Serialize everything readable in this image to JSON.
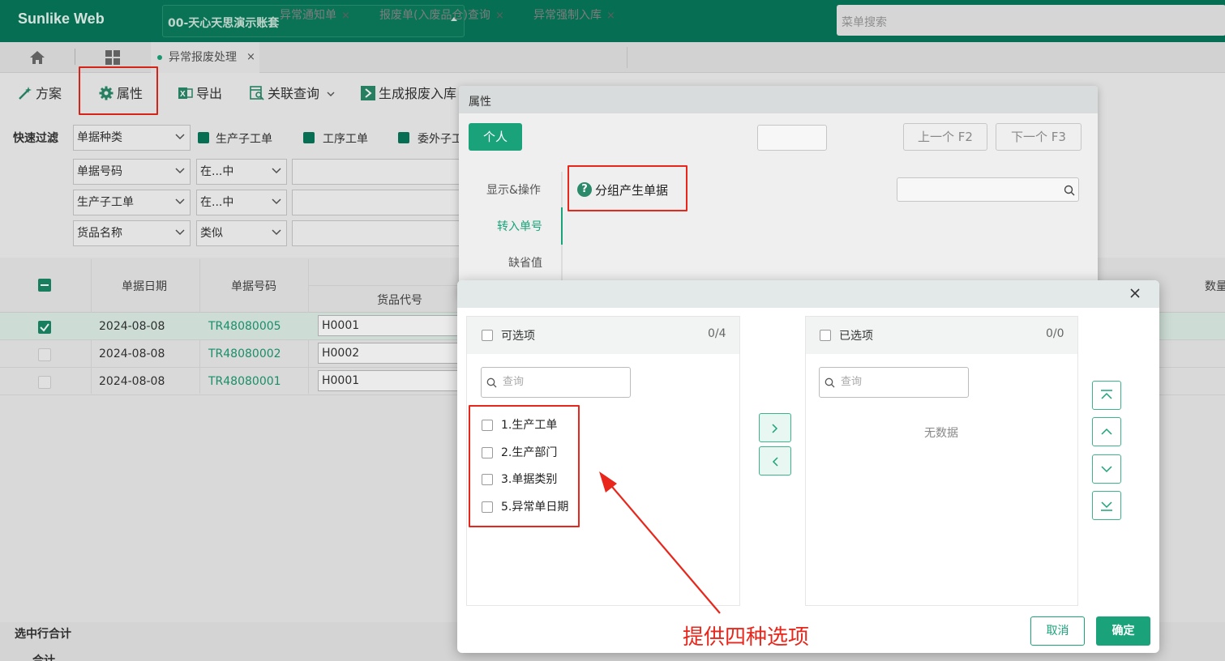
{
  "app": {
    "title": "Sunlike Web",
    "account": "00-天心天思演示账套",
    "menu_search_placeholder": "菜单搜索"
  },
  "tabs": [
    {
      "label": "异常报废处理",
      "active": true
    },
    {
      "label": "异常通知单"
    },
    {
      "label": "报废单(入废品仓)查询"
    },
    {
      "label": "异常强制入库"
    }
  ],
  "toolbar": {
    "scheme": "方案",
    "property": "属性",
    "export": "导出",
    "related_query": "关联查询",
    "generate": "生成报废入库"
  },
  "filters": {
    "quick_filter_label": "快速过滤",
    "doc_type": "单据种类",
    "check_production_order": "生产子工单",
    "check_process_order": "工序工单",
    "check_outsource": "委外子工",
    "rows": [
      {
        "field": "单据号码",
        "op": "在...中"
      },
      {
        "field": "生产子工单",
        "op": "在...中"
      },
      {
        "field": "货品名称",
        "op": "类似"
      }
    ]
  },
  "grid": {
    "headers": {
      "date": "单据日期",
      "number": "单据号码",
      "item_code": "货品代号",
      "qty": "数量"
    },
    "rows": [
      {
        "date": "2024-08-08",
        "number": "TR48080005",
        "code": "H0001",
        "checked": true
      },
      {
        "date": "2024-08-08",
        "number": "TR48080002",
        "code": "H0002",
        "checked": false
      },
      {
        "date": "2024-08-08",
        "number": "TR48080001",
        "code": "H0001",
        "checked": false
      }
    ]
  },
  "footer": {
    "selected_total": "选中行合计",
    "total": "合计"
  },
  "prop_dialog": {
    "title": "属性",
    "personal": "个人",
    "prev": "上一个 F2",
    "next": "下一个 F3",
    "side": [
      "显示&操作",
      "转入单号",
      "缺省值"
    ],
    "group_label": "分组产生单据"
  },
  "group_dialog": {
    "available_title": "可选项",
    "available_count": "0/4",
    "selected_title": "已选项",
    "selected_count": "0/0",
    "search_placeholder": "查询",
    "options": [
      "1.生产工单",
      "2.生产部门",
      "3.单据类别",
      "5.异常单日期"
    ],
    "no_data": "无数据",
    "cancel": "取消",
    "ok": "确定"
  },
  "annotation": "提供四种选项",
  "colors": {
    "brand": "#07785a",
    "accent": "#1aa37a",
    "annotation": "#e8261b"
  }
}
